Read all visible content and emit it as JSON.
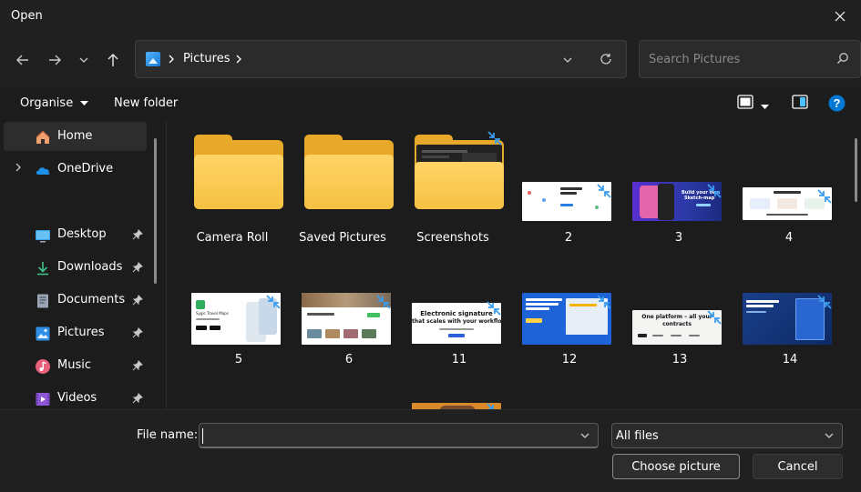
{
  "window": {
    "title": "Open"
  },
  "address": {
    "root_icon": "pictures-icon",
    "location": "Pictures"
  },
  "search": {
    "placeholder": "Search Pictures"
  },
  "commands": {
    "organise": "Organise",
    "new_folder": "New folder"
  },
  "sidebar": {
    "items": [
      {
        "label": "Home",
        "icon": "home-icon",
        "selected": true
      },
      {
        "label": "OneDrive",
        "icon": "onedrive-icon",
        "expandable": true
      },
      {
        "label": "Desktop",
        "icon": "desktop-icon",
        "pinned": true
      },
      {
        "label": "Downloads",
        "icon": "downloads-icon",
        "pinned": true
      },
      {
        "label": "Documents",
        "icon": "documents-icon",
        "pinned": true
      },
      {
        "label": "Pictures",
        "icon": "pictures-icon",
        "pinned": true
      },
      {
        "label": "Music",
        "icon": "music-icon",
        "pinned": true
      },
      {
        "label": "Videos",
        "icon": "videos-icon",
        "pinned": true
      }
    ]
  },
  "files": [
    {
      "name": "Camera Roll",
      "type": "folder"
    },
    {
      "name": "Saved Pictures",
      "type": "folder"
    },
    {
      "name": "Screenshots",
      "type": "folder"
    },
    {
      "name": "2",
      "type": "image"
    },
    {
      "name": "3",
      "type": "image"
    },
    {
      "name": "4",
      "type": "image"
    },
    {
      "name": "5",
      "type": "image"
    },
    {
      "name": "6",
      "type": "image"
    },
    {
      "name": "11",
      "type": "image"
    },
    {
      "name": "12",
      "type": "image"
    },
    {
      "name": "13",
      "type": "image"
    },
    {
      "name": "14",
      "type": "image"
    }
  ],
  "thumb_text": {
    "t11_line1": "Electronic signature",
    "t11_line2": "that scales with your workflow",
    "t13_line1": "One platform – all your",
    "t13_line2": "contracts",
    "t3_line1": "Build your own",
    "t3_line2": "Sketch-map",
    "t5_title": "Sygic Travel Maps"
  },
  "footer": {
    "file_name_label": "File name:",
    "file_name_value": "",
    "file_type": "All files",
    "primary_button": "Choose picture",
    "cancel_button": "Cancel"
  },
  "colors": {
    "accent": "#0078d4",
    "folder": "#f5c142",
    "help": "#0078d4"
  }
}
